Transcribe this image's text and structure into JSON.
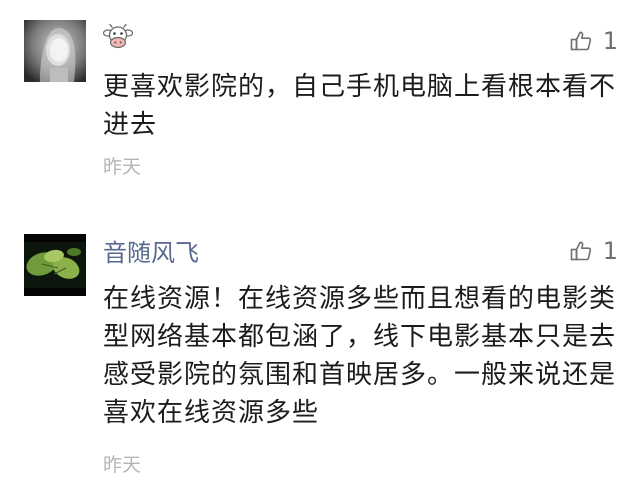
{
  "comments": [
    {
      "author": "",
      "author_icon": "cow-face-icon",
      "likes": "1",
      "text": "更喜欢影院的，自己手机电脑上看根本看不进去",
      "time": "昨天"
    },
    {
      "author": "音随风飞",
      "likes": "1",
      "text": "在线资源！在线资源多些而且想看的电影类型网络基本都包涵了，线下电影基本只是去感受影院的氛围和首映居多。一般来说还是喜欢在线资源多些",
      "time": "昨天"
    }
  ],
  "colors": {
    "author": "#58698f",
    "body_text": "#1c1c1c",
    "meta_text": "#b5b5b5",
    "like_icon": "#707070"
  },
  "icons": {
    "like": "thumbs-up-icon"
  }
}
